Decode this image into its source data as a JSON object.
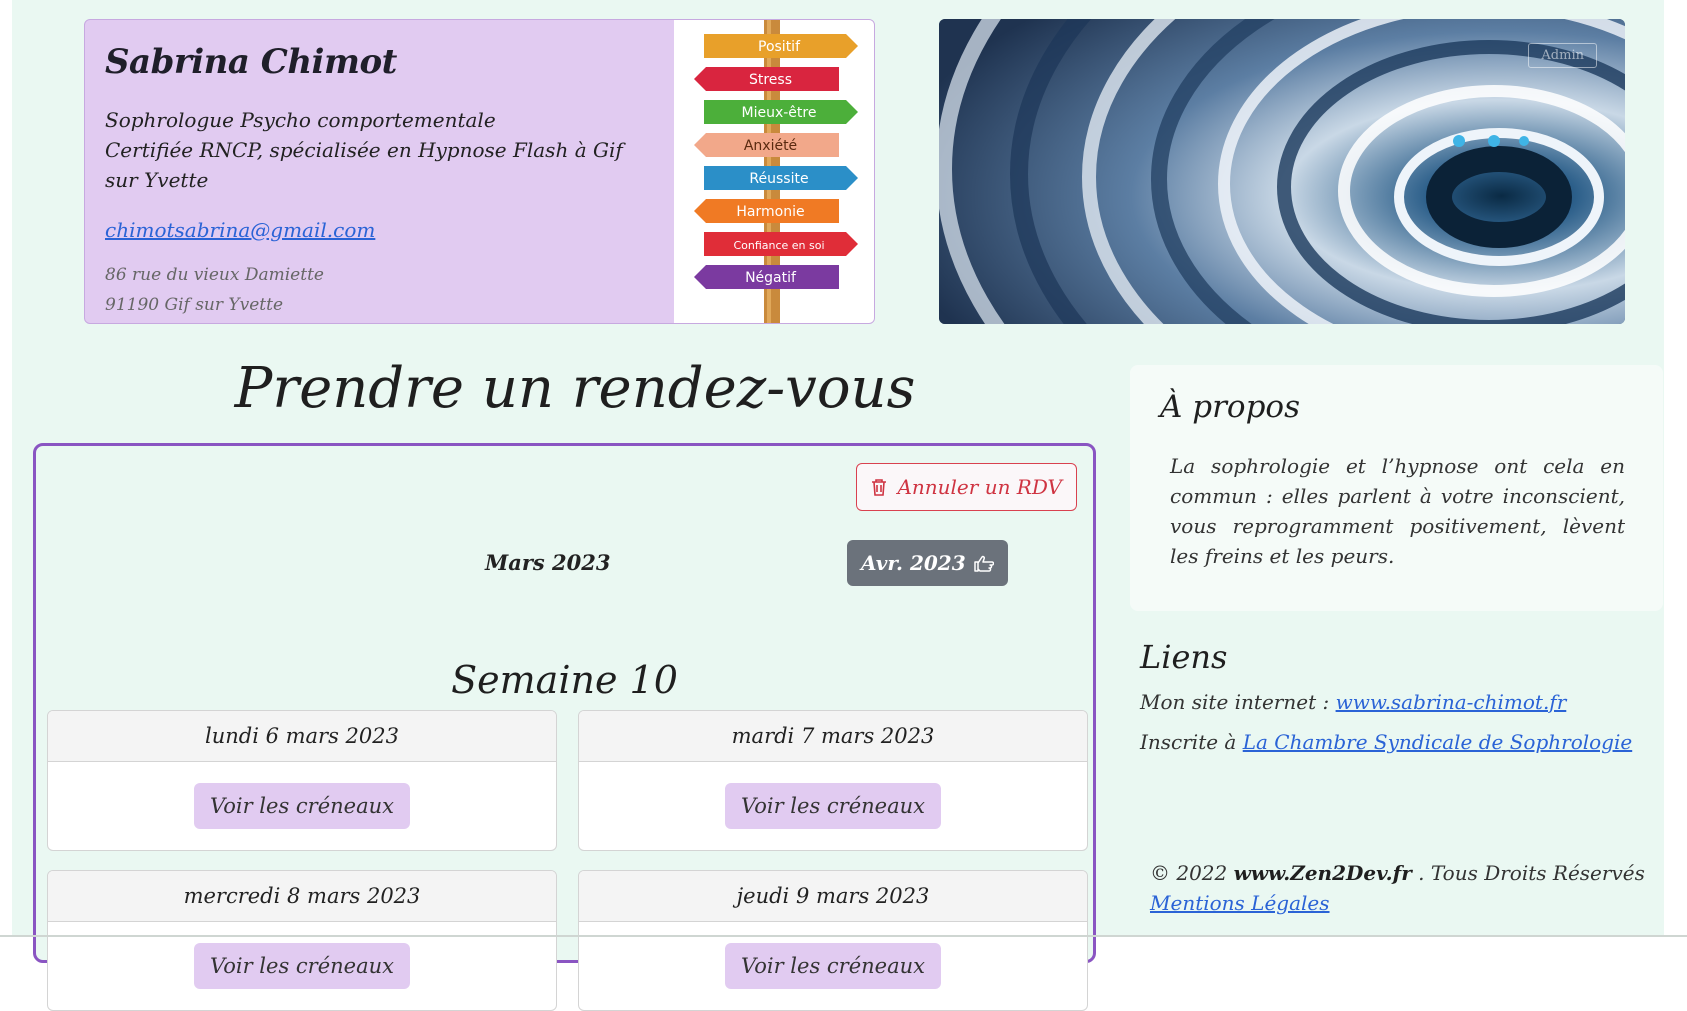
{
  "header": {
    "name": "Sabrina Chimot",
    "description_lines": [
      "Sophrologue Psycho comportementale",
      "Certifiée RNCP, spécialisée en Hypnose Flash à Gif sur Yvette"
    ],
    "email": "chimotsabrina@gmail.com",
    "address_lines": [
      "86 rue du vieux Damiette",
      "91190 Gif sur Yvette"
    ],
    "signpost_words": [
      "Positif",
      "Stress",
      "Mieux-être",
      "Anxiété",
      "Réussite",
      "Harmonie",
      "Confiance en soi",
      "Négatif"
    ],
    "signpost_colors": [
      "#e8a02a",
      "#d9253f",
      "#4caf3a",
      "#f2a88a",
      "#2b8fc8",
      "#f07a24",
      "#e02d38",
      "#7b3aa0"
    ],
    "image_link": "Admin"
  },
  "booking": {
    "title": "Prendre un rendez-vous",
    "cancel_label": "Annuler un RDV",
    "cancel_icon": "trash-icon",
    "current_month": "Mars 2023",
    "next_month_label": "Avr. 2023",
    "next_month_icon": "hand-point-right-icon",
    "week_label": "Semaine 10",
    "days": [
      {
        "label": "lundi 6 mars 2023",
        "button": "Voir les créneaux"
      },
      {
        "label": "mardi 7 mars 2023",
        "button": "Voir les créneaux"
      },
      {
        "label": "mercredi 8 mars 2023",
        "button": "Voir les créneaux"
      },
      {
        "label": "jeudi 9 mars 2023",
        "button": "Voir les créneaux"
      }
    ]
  },
  "about": {
    "title": "À propos",
    "text": "La sophrologie et l’hypnose ont cela en commun : elles parlent à votre inconscient, vous reprogramment positivement, lèvent les freins et les peurs."
  },
  "links": {
    "title": "Liens",
    "site_prefix": "Mon site internet : ",
    "site_link": "www.sabrina-chimot.fr",
    "chamber_prefix": "Inscrite à ",
    "chamber_link": "La Chambre Syndicale de Sophrologie"
  },
  "footer": {
    "copyright_prefix": "© 2022 ",
    "brand": "www.Zen2Dev.fr",
    "rights": " . Tous Droits Réservés",
    "legal_link": "Mentions Légales"
  },
  "colors": {
    "page_bg": "#eaf8f2",
    "card_purple": "#e1cbf1",
    "booking_border": "#8a55c2",
    "cancel_red": "#cf3442",
    "next_btn_gray": "#6b727b",
    "link_blue": "#2a63d6"
  }
}
